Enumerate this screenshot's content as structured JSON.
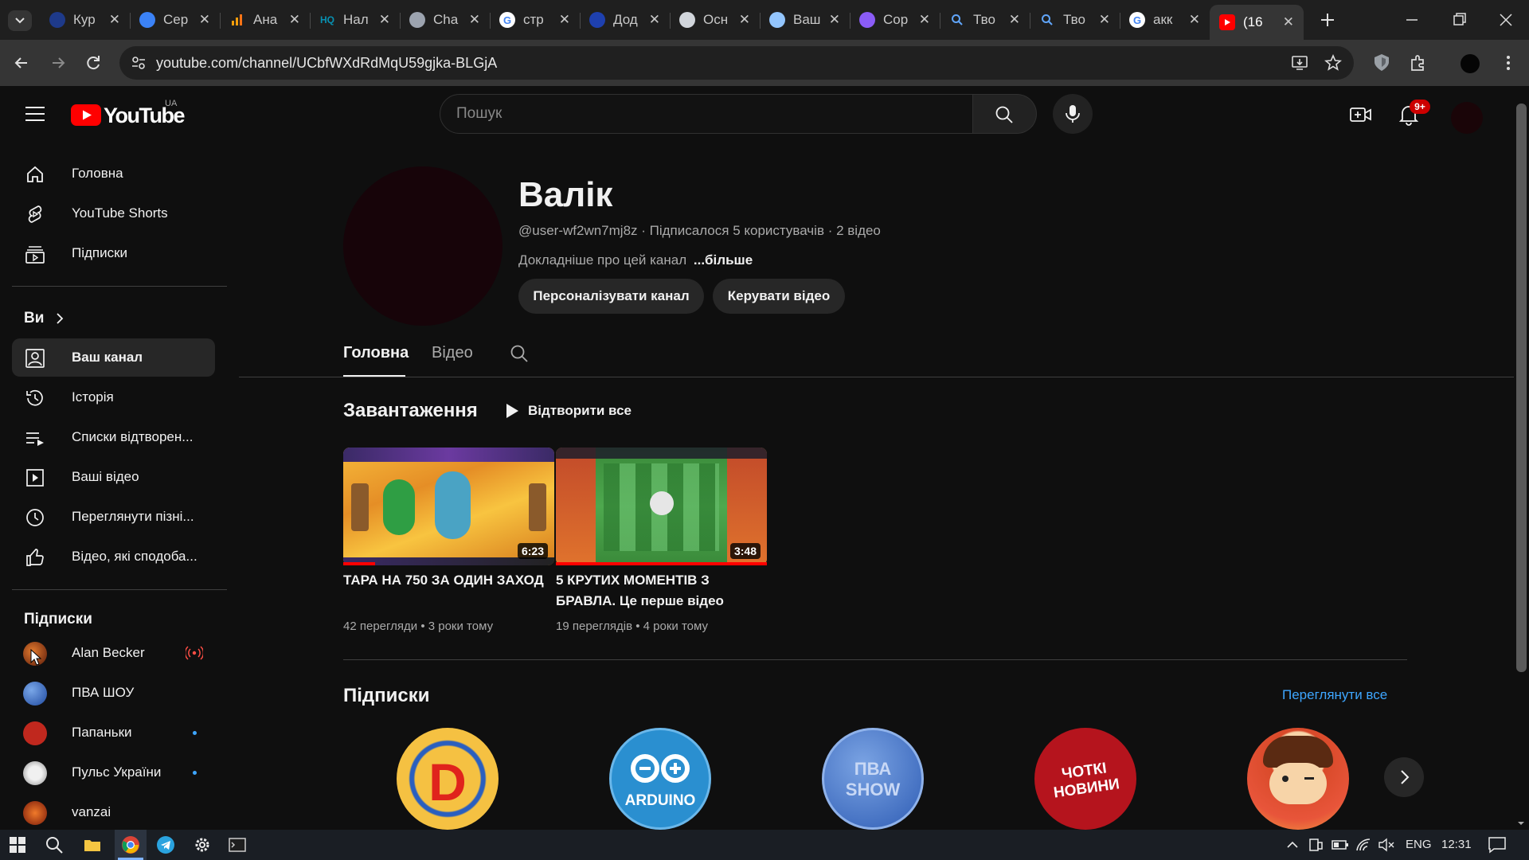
{
  "browser": {
    "tabs": [
      {
        "icon": "ukrainian-emblem-icon",
        "title": "Кур",
        "color": "#1e3a8a"
      },
      {
        "icon": "moon-icon",
        "title": "Сер",
        "color": "#3b82f6"
      },
      {
        "icon": "analytics-icon",
        "title": "Ана",
        "color": "#f59e0b"
      },
      {
        "icon": "hq-icon",
        "title": "Нал",
        "color": "#0891b2"
      },
      {
        "icon": "chatgpt-icon",
        "title": "Cha",
        "color": "#9ca3af"
      },
      {
        "icon": "google-icon",
        "title": "стр",
        "color": "#ffffff"
      },
      {
        "icon": "moon-icon",
        "title": "Дод",
        "color": "#1e40af"
      },
      {
        "icon": "building-icon",
        "title": "Осн",
        "color": "#d1d5db"
      },
      {
        "icon": "screenshot-icon",
        "title": "Ваш",
        "color": "#93c5fd"
      },
      {
        "icon": "copilot-icon",
        "title": "Cop",
        "color": "#8b5cf6"
      },
      {
        "icon": "search-icon",
        "title": "Тво",
        "color": "#60a5fa"
      },
      {
        "icon": "search-icon",
        "title": "Тво",
        "color": "#60a5fa"
      },
      {
        "icon": "google-icon",
        "title": "акк",
        "color": "#ffffff"
      },
      {
        "icon": "youtube-icon",
        "title": "(16",
        "color": "#ff0000"
      }
    ],
    "url": "youtube.com/channel/UCbfWXdRdMqU59gjka-BLGjA"
  },
  "yt": {
    "logo_text": "YouTube",
    "region": "UA",
    "search_placeholder": "Пошук",
    "notif_badge": "9+",
    "guide": {
      "main": [
        "Головна",
        "YouTube Shorts",
        "Підписки"
      ],
      "you_header": "Ви",
      "you": [
        "Ваш канал",
        "Історія",
        "Списки відтворен...",
        "Ваші відео",
        "Переглянути пізні...",
        "Відео, які сподоба..."
      ],
      "subs_header": "Підписки",
      "subs": [
        "Alan Becker",
        "ПВА ШОУ",
        "Папаньки",
        "Пульс України",
        "vanzai"
      ]
    },
    "channel": {
      "name": "Валік",
      "meta": "@user-wf2wn7mj8z · Підписалося 5 користувачів · 2 відео",
      "about": "Докладніше про цей канал",
      "more": "...більше",
      "btn_customize": "Персоналізувати канал",
      "btn_manage": "Керувати відео",
      "tabs": [
        "Головна",
        "Відео"
      ]
    },
    "uploads": {
      "title": "Завантаження",
      "play_all": "Відтворити все",
      "videos": [
        {
          "title": "ТАРА НА 750 ЗА ОДИН ЗАХОД",
          "meta": "42 перегляди • 3 роки тому",
          "duration": "6:23"
        },
        {
          "title": "5 КРУТИХ МОМЕНТІВ З БРАВЛА. Це перше відео",
          "meta": "19 переглядів • 4 роки тому",
          "duration": "3:48"
        }
      ]
    },
    "subscriptions": {
      "title": "Підписки",
      "view_all": "Переглянути все",
      "channels": [
        {
          "label": "D",
          "color": "#f5a623"
        },
        {
          "label": "ARDUINO",
          "color": "#2a8fd0"
        },
        {
          "label": "ПВА SHOW",
          "color": "#3a6fc4"
        },
        {
          "label": "ЧОТКІ НОВИНИ",
          "color": "#b5141d"
        },
        {
          "label": "",
          "color": "#e8553a"
        }
      ]
    }
  },
  "taskbar": {
    "lang": "ENG",
    "time": "12:31"
  }
}
